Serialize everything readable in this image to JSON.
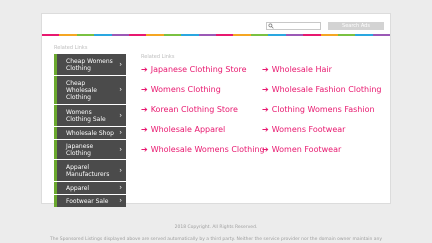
{
  "search": {
    "placeholder": "",
    "button_label": "Search Ads"
  },
  "stripe_colors": [
    "#e8186f",
    "#f5a623",
    "#7ac142",
    "#2aa7e0",
    "#9b59b6",
    "#e8186f",
    "#f5a623",
    "#7ac142",
    "#2aa7e0",
    "#9b59b6",
    "#e8186f",
    "#f5a623",
    "#7ac142",
    "#2aa7e0",
    "#9b59b6",
    "#e8186f",
    "#f5a623",
    "#7ac142",
    "#2aa7e0",
    "#9b59b6"
  ],
  "sidebar": {
    "title": "Related Links",
    "items": [
      {
        "label": "Cheap Womens Clothing"
      },
      {
        "label": "Cheap Wholesale Clothing"
      },
      {
        "label": "Womens Clothing Sale"
      },
      {
        "label": "Wholesale Shop"
      },
      {
        "label": "Japanese Clothing"
      },
      {
        "label": "Apparel Manufacturers"
      },
      {
        "label": "Apparel"
      },
      {
        "label": "Footwear Sale"
      }
    ]
  },
  "related": {
    "title": "Related Links",
    "left_links": [
      {
        "label": "Japanese Clothing Store"
      },
      {
        "label": "Womens Clothing"
      },
      {
        "label": "Korean Clothing Store"
      },
      {
        "label": "Wholesale Apparel"
      },
      {
        "label": "Wholesale Womens Clothing"
      }
    ],
    "right_links": [
      {
        "label": "Wholesale Hair"
      },
      {
        "label": "Wholesale Fashion Clothing"
      },
      {
        "label": "Clothing Womens Fashion"
      },
      {
        "label": "Womens Footwear"
      },
      {
        "label": "Women Footwear"
      }
    ]
  },
  "footer": {
    "copyright": "2018 Copyright. All Rights Reserved.",
    "disclaimer": "The Sponsored Listings displayed above are served automatically by a third party. Neither the service provider nor the domain owner maintain any"
  },
  "colors": {
    "link": "#e8186f",
    "sidebar_bg": "#4b4b4b",
    "sidebar_accent": "#6aa82e"
  }
}
